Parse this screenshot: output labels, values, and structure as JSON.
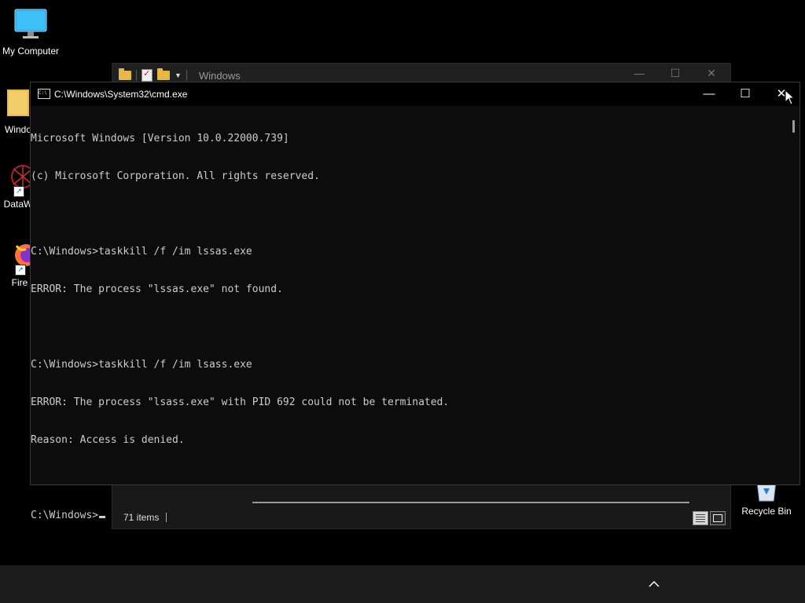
{
  "desktop": {
    "icons": [
      {
        "label": "My Computer",
        "icon": "monitor-icon"
      },
      {
        "label": "Windo",
        "icon": "folder-icon"
      },
      {
        "label": "DataW",
        "icon": "datawrangler-icon"
      },
      {
        "label": "Fire",
        "icon": "firefox-icon"
      },
      {
        "label": "Recycle Bin",
        "icon": "recycle-bin-icon"
      }
    ]
  },
  "explorer": {
    "title": "Windows",
    "status_count": "71 items",
    "controls": {
      "minimize": "—",
      "maximize": "☐",
      "close": "✕"
    }
  },
  "cmd": {
    "title": "C:\\Windows\\System32\\cmd.exe",
    "controls": {
      "minimize": "—",
      "maximize": "☐",
      "close": "✕"
    },
    "lines": [
      "Microsoft Windows [Version 10.0.22000.739]",
      "(c) Microsoft Corporation. All rights reserved.",
      "",
      "C:\\Windows>taskkill /f /im lssas.exe",
      "ERROR: The process \"lssas.exe\" not found.",
      "",
      "C:\\Windows>taskkill /f /im lsass.exe",
      "ERROR: The process \"lsass.exe\" with PID 692 could not be terminated.",
      "Reason: Access is denied.",
      ""
    ],
    "prompt": "C:\\Windows>"
  },
  "taskbar": {
    "tray_chevron": "^"
  },
  "colors": {
    "console_bg": "#0c0c0c",
    "console_text": "#cccccc",
    "taskbar": "#1c1c1c",
    "folder": "#e8b746"
  }
}
